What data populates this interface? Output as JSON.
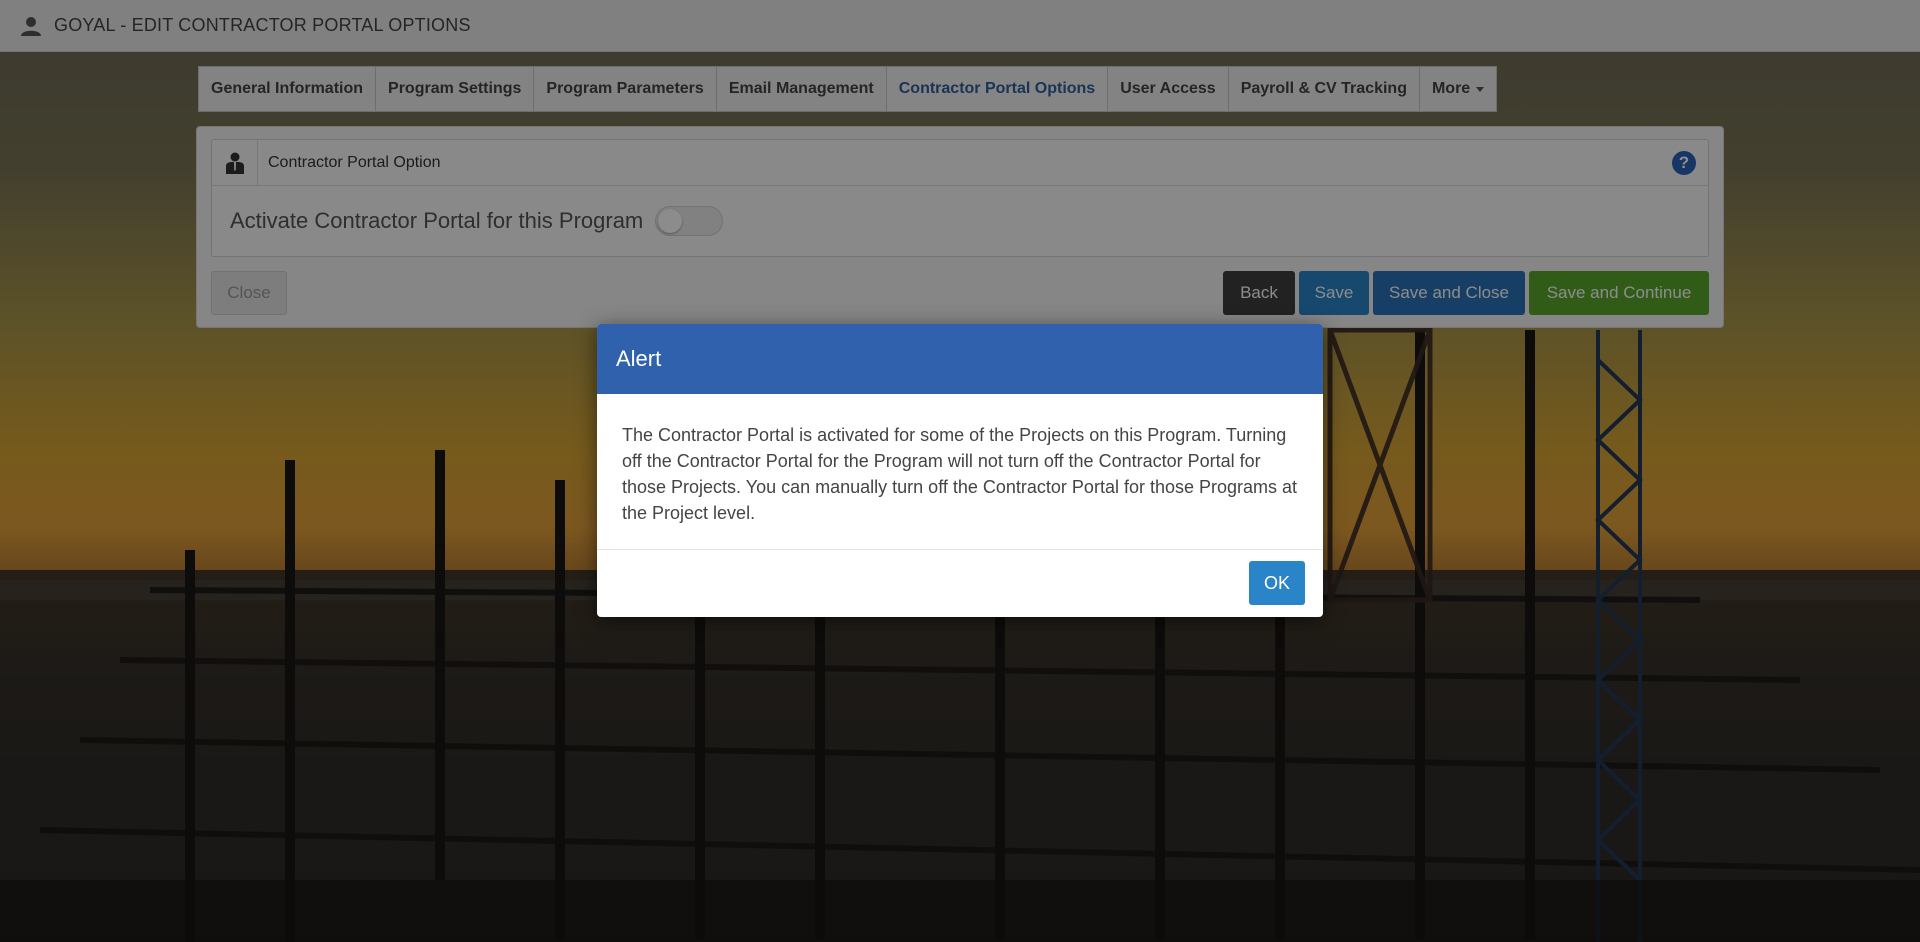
{
  "header": {
    "title": "GOYAL - EDIT CONTRACTOR PORTAL OPTIONS",
    "user_icon": "user-icon"
  },
  "tabs": [
    {
      "label": "General Information",
      "active": false
    },
    {
      "label": "Program Settings",
      "active": false
    },
    {
      "label": "Program Parameters",
      "active": false
    },
    {
      "label": "Email Management",
      "active": false
    },
    {
      "label": "Contractor Portal Options",
      "active": true
    },
    {
      "label": "User Access",
      "active": false
    },
    {
      "label": "Payroll & CV Tracking",
      "active": false
    },
    {
      "label": "More",
      "active": false
    }
  ],
  "section": {
    "icon": "contractor-icon",
    "title": "Contractor Portal Option",
    "help_icon": "?",
    "activate_label": "Activate Contractor Portal for this Program",
    "activate_on": false
  },
  "actions": {
    "close": "Close",
    "back": "Back",
    "save": "Save",
    "save_close": "Save and Close",
    "save_continue": "Save and Continue"
  },
  "modal": {
    "title": "Alert",
    "body": "The Contractor Portal is activated for some of the Projects on this Program. Turning off the Contractor Portal for the Program will not turn off the Contractor Portal for those Projects. You can manually turn off the Contractor Portal for those Programs at the Project level.",
    "ok": "OK"
  },
  "colors": {
    "modal_header": "#2f61ad",
    "active_tab": "#2f5f9e",
    "save_blue": "#2a84c8",
    "continue_green": "#5aa82a"
  }
}
